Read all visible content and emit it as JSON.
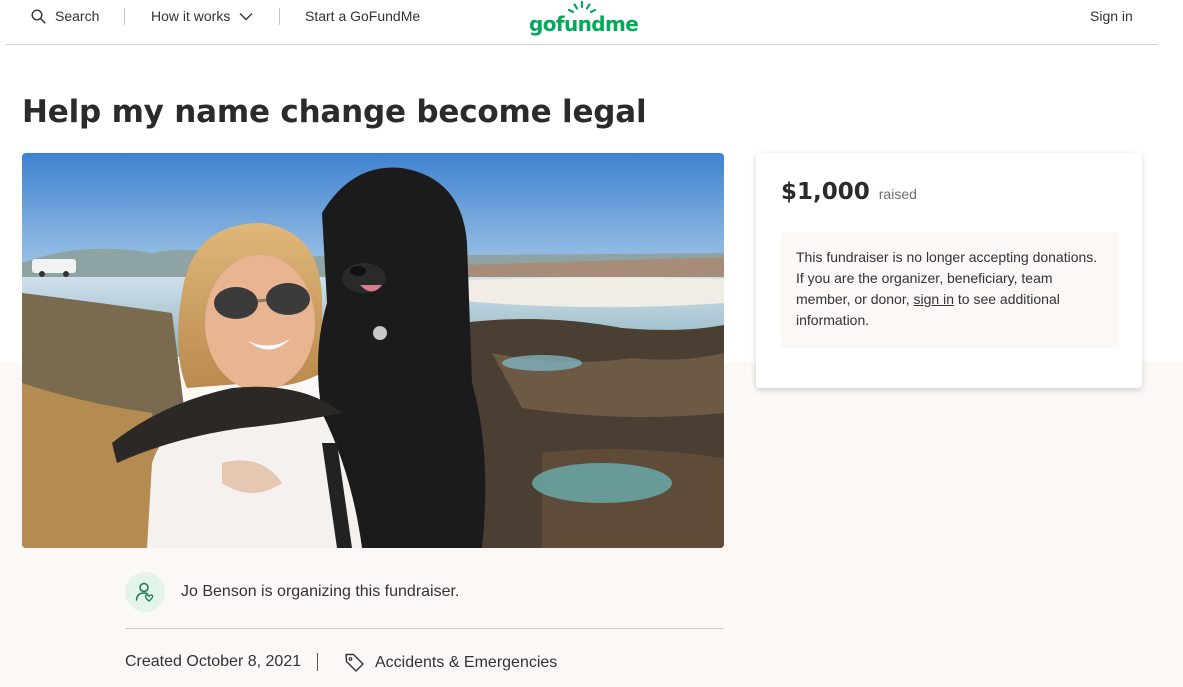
{
  "header": {
    "search_label": "Search",
    "how_label": "How it works",
    "start_label": "Start a GoFundMe",
    "logo_text": "gofundme",
    "signin_label": "Sign in"
  },
  "page": {
    "title": "Help my name change become legal"
  },
  "donation": {
    "amount": "$1,000",
    "amount_label": "raised",
    "notice_before": "This fundraiser is no longer accepting donations. If you are the organizer, beneficiary, team member, or donor, ",
    "notice_link": "sign in",
    "notice_after": " to see additional information."
  },
  "organizer": {
    "text": "Jo Benson is organizing this fundraiser."
  },
  "meta": {
    "created": "Created October 8, 2021",
    "category": "Accidents & Emergencies"
  },
  "colors": {
    "brand_green": "#02a95c",
    "cream": "#fbf8f6",
    "text": "#333333"
  },
  "icons": [
    "search-icon",
    "chevron-down-icon",
    "organizer-icon",
    "tag-icon"
  ]
}
